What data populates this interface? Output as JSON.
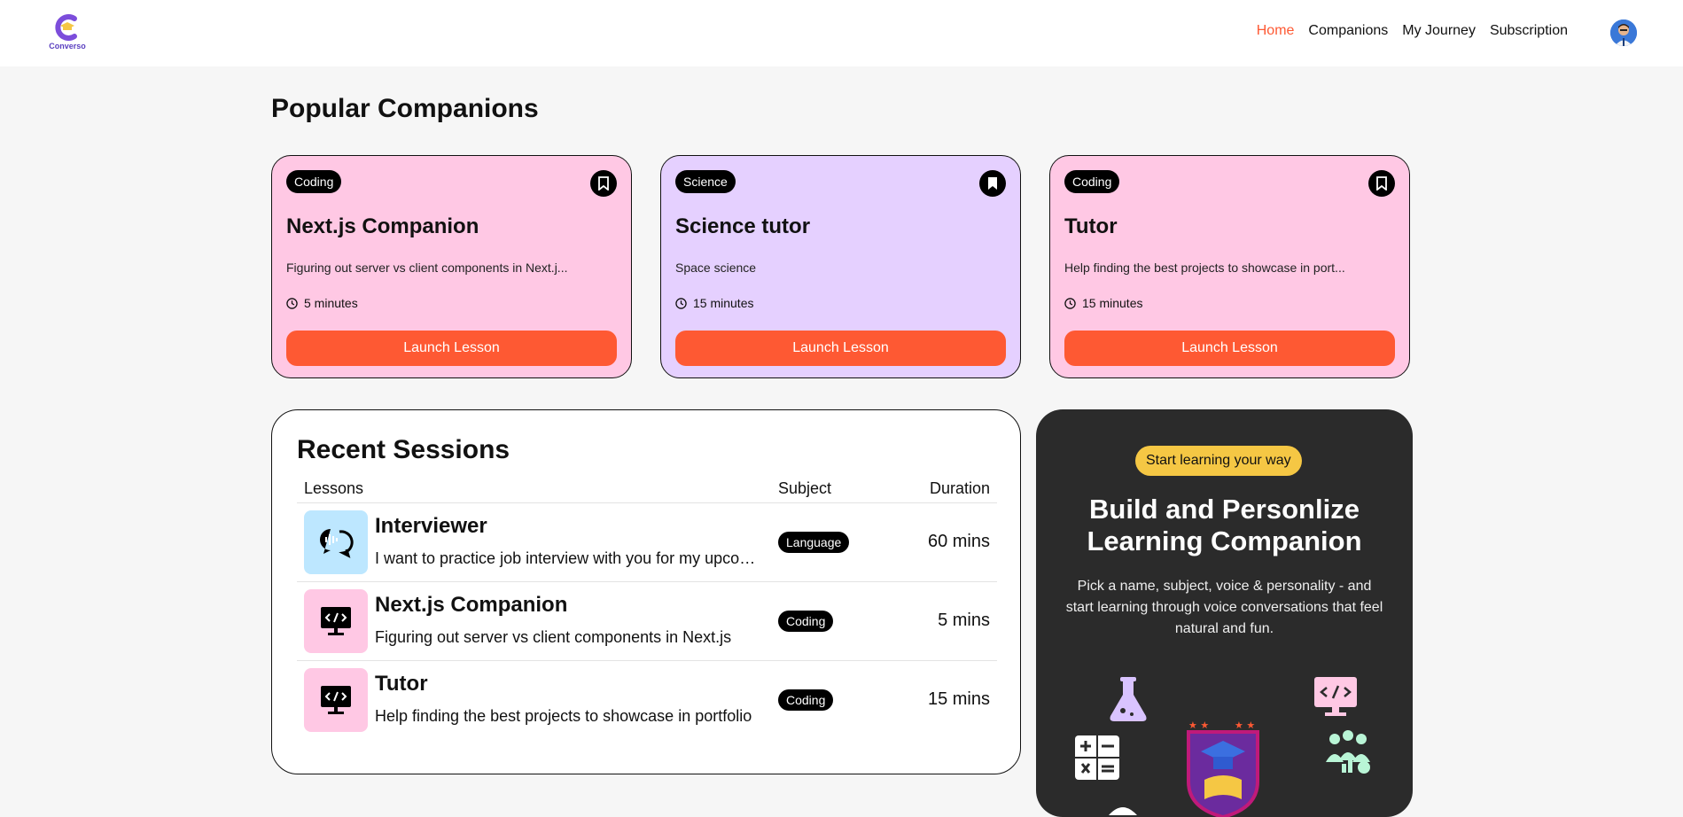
{
  "brand": {
    "name": "Converso",
    "accent": "#fe5933"
  },
  "nav": {
    "items": [
      {
        "label": "Home",
        "active": true
      },
      {
        "label": "Companions",
        "active": false
      },
      {
        "label": "My Journey",
        "active": false
      },
      {
        "label": "Subscription",
        "active": false
      }
    ]
  },
  "popular": {
    "title": "Popular Companions",
    "cards": [
      {
        "subject": "Coding",
        "name": "Next.js Companion",
        "topic": "Figuring out server vs client components in Next.j...",
        "duration": "5 minutes",
        "cta": "Launch Lesson",
        "bg": "#ffc8e4",
        "bookmarked": false
      },
      {
        "subject": "Science",
        "name": "Science tutor",
        "topic": "Space science",
        "duration": "15 minutes",
        "cta": "Launch Lesson",
        "bg": "#e5d0ff",
        "bookmarked": true
      },
      {
        "subject": "Coding",
        "name": "Tutor",
        "topic": "Help finding the best projects to showcase in port...",
        "duration": "15 minutes",
        "cta": "Launch Lesson",
        "bg": "#ffc8e4",
        "bookmarked": false
      }
    ]
  },
  "recent": {
    "title": "Recent Sessions",
    "columns": {
      "lessons": "Lessons",
      "subject": "Subject",
      "duration": "Duration"
    },
    "rows": [
      {
        "name": "Interviewer",
        "topic": "I want to practice job interview with you for my upcoming interview",
        "subject": "Language",
        "duration": "60 mins",
        "icon": "audio-wave-chat-icon",
        "iconBg": "#bde7ff"
      },
      {
        "name": "Next.js Companion",
        "topic": "Figuring out server vs client components in Next.js",
        "subject": "Coding",
        "duration": "5 mins",
        "icon": "code-monitor-icon",
        "iconBg": "#ffc8e4"
      },
      {
        "name": "Tutor",
        "topic": "Help finding the best projects to showcase in portfolio",
        "subject": "Coding",
        "duration": "15 mins",
        "icon": "code-monitor-icon",
        "iconBg": "#ffc8e4"
      }
    ]
  },
  "cta": {
    "badge": "Start learning your way",
    "title_line1": "Build and Personlize",
    "title_line2": "Learning Companion",
    "description": "Pick a name, subject, voice & personality - and start learning through voice conversations that feel natural and fun."
  }
}
